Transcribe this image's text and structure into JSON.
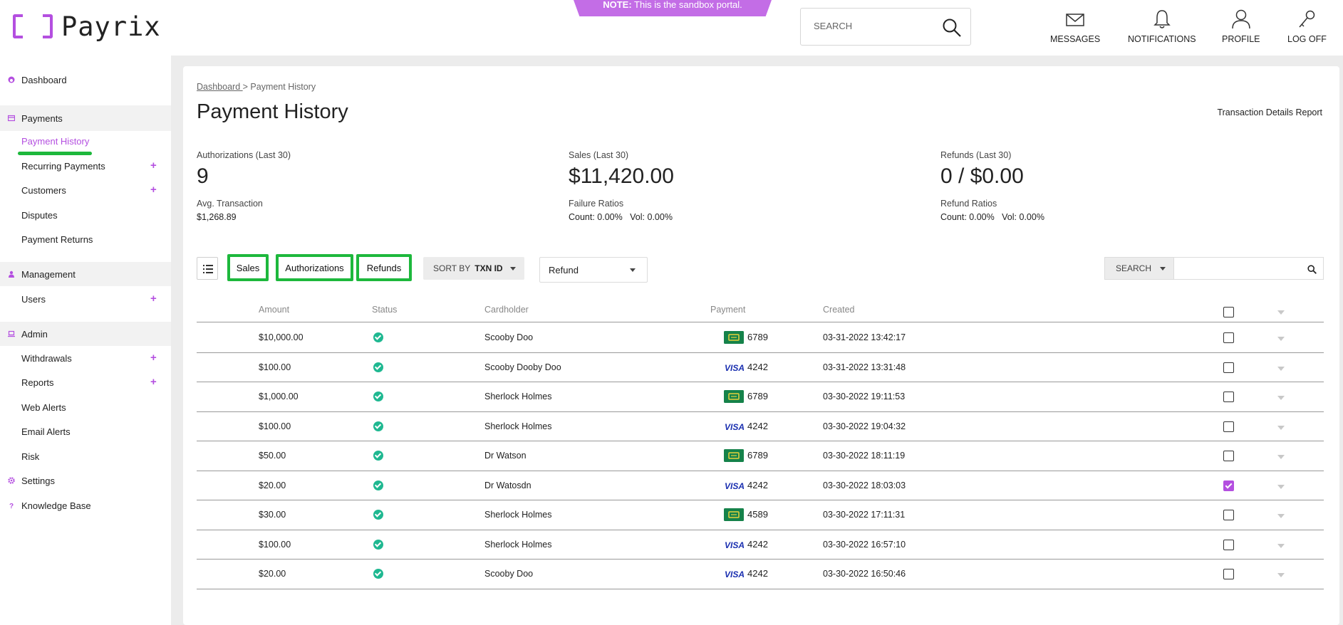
{
  "brand": {
    "name": "Payrix",
    "accent": "#b44fe0",
    "highlight": "#1db83c",
    "status_ok": "#1fb891"
  },
  "sandbox_note": {
    "bold": "NOTE:",
    "text": " This is the sandbox portal."
  },
  "header": {
    "search_placeholder": "SEARCH",
    "nav": [
      {
        "label": "MESSAGES",
        "icon": "envelope-icon"
      },
      {
        "label": "NOTIFICATIONS",
        "icon": "bell-icon"
      },
      {
        "label": "PROFILE",
        "icon": "user-icon"
      },
      {
        "label": "LOG OFF",
        "icon": "key-icon"
      }
    ]
  },
  "sidebar": {
    "dashboard": "Dashboard",
    "payments": {
      "label": "Payments",
      "items": [
        "Payment History",
        "Recurring Payments",
        "Customers",
        "Disputes",
        "Payment Returns"
      ]
    },
    "management": {
      "label": "Management",
      "items": [
        "Users"
      ]
    },
    "admin": {
      "label": "Admin",
      "items": [
        "Withdrawals",
        "Reports",
        "Web Alerts",
        "Email Alerts",
        "Risk"
      ]
    },
    "settings": "Settings",
    "knowledge_base": "Knowledge Base",
    "plus": "+"
  },
  "breadcrumb": {
    "parent": "Dashboard ",
    "sep": "> ",
    "current": "Payment History"
  },
  "page_title": "Payment History",
  "report_link": "Transaction Details Report",
  "stats": {
    "authorizations": {
      "label": "Authorizations (Last 30)",
      "value": "9",
      "sub_label": "Avg. Transaction",
      "sub_value": "$1,268.89"
    },
    "sales": {
      "label": "Sales (Last 30)",
      "value": "$11,420.00",
      "sub_label": "Failure Ratios",
      "sub_value": "Count: 0.00%   Vol: 0.00%"
    },
    "refunds": {
      "label": "Refunds (Last 30)",
      "value": "0 / $0.00",
      "sub_label": "Refund Ratios",
      "sub_value": "Count: 0.00%   Vol: 0.00%"
    }
  },
  "toolbar": {
    "filters": [
      "Sales",
      "Authorizations",
      "Refunds"
    ],
    "sort_by": "SORT BY",
    "sort_field": "TXN ID",
    "type_select": "Refund",
    "search_label": "SEARCH"
  },
  "table": {
    "columns": [
      "Amount",
      "Status",
      "Cardholder",
      "Payment",
      "Created"
    ],
    "rows": [
      {
        "amount": "$10,000.00",
        "cardholder": "Scooby Doo",
        "card": "generic",
        "last4": "6789",
        "created": "03-31-2022 13:42:17",
        "checked": false
      },
      {
        "amount": "$100.00",
        "cardholder": "Scooby Dooby Doo",
        "card": "visa",
        "last4": "4242",
        "created": "03-31-2022 13:31:48",
        "checked": false
      },
      {
        "amount": "$1,000.00",
        "cardholder": "Sherlock Holmes",
        "card": "generic",
        "last4": "6789",
        "created": "03-30-2022 19:11:53",
        "checked": false
      },
      {
        "amount": "$100.00",
        "cardholder": "Sherlock Holmes",
        "card": "visa",
        "last4": "4242",
        "created": "03-30-2022 19:04:32",
        "checked": false
      },
      {
        "amount": "$50.00",
        "cardholder": "Dr Watson",
        "card": "generic",
        "last4": "6789",
        "created": "03-30-2022 18:11:19",
        "checked": false
      },
      {
        "amount": "$20.00",
        "cardholder": "Dr Watosdn",
        "card": "visa",
        "last4": "4242",
        "created": "03-30-2022 18:03:03",
        "checked": true
      },
      {
        "amount": "$30.00",
        "cardholder": "Sherlock Holmes",
        "card": "generic",
        "last4": "4589",
        "created": "03-30-2022 17:11:31",
        "checked": false
      },
      {
        "amount": "$100.00",
        "cardholder": "Sherlock Holmes",
        "card": "visa",
        "last4": "4242",
        "created": "03-30-2022 16:57:10",
        "checked": false
      },
      {
        "amount": "$20.00",
        "cardholder": "Scooby Doo",
        "card": "visa",
        "last4": "4242",
        "created": "03-30-2022 16:50:46",
        "checked": false
      }
    ]
  },
  "visa_text": "VISA"
}
